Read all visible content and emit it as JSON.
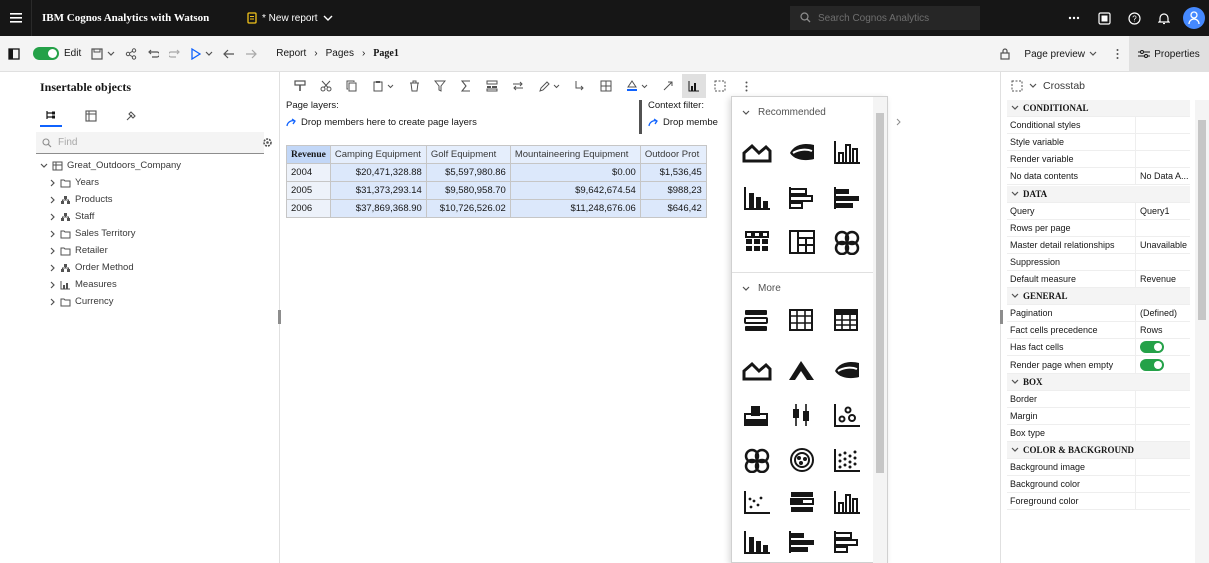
{
  "app": {
    "title": "IBM Cognos Analytics with Watson",
    "report_name": "* New report",
    "search_placeholder": "Search Cognos Analytics"
  },
  "toolbar": {
    "edit_label": "Edit",
    "breadcrumb": [
      "Report",
      "Pages",
      "Page1"
    ],
    "page_preview_label": "Page preview",
    "properties_label": "Properties"
  },
  "left_panel": {
    "title": "Insertable objects",
    "find_placeholder": "Find",
    "tree_root": "Great_Outdoors_Company",
    "tree_items": [
      {
        "label": "Years",
        "icon": "folder-icon"
      },
      {
        "label": "Products",
        "icon": "hierarchy-icon"
      },
      {
        "label": "Staff",
        "icon": "hierarchy-icon"
      },
      {
        "label": "Sales Territory",
        "icon": "folder-icon"
      },
      {
        "label": "Retailer",
        "icon": "folder-icon"
      },
      {
        "label": "Order Method",
        "icon": "hierarchy-icon"
      },
      {
        "label": "Measures",
        "icon": "measure-icon"
      },
      {
        "label": "Currency",
        "icon": "folder-icon"
      }
    ]
  },
  "page_layers": {
    "label": "Page layers:",
    "drop_text": "Drop members here to create page layers"
  },
  "context_filter": {
    "label": "Context filter:",
    "drop_text": "Drop membe"
  },
  "crosstab": {
    "corner": "Revenue",
    "columns": [
      "Camping Equipment",
      "Golf Equipment",
      "Mountaineering Equipment",
      "Outdoor Prot"
    ],
    "rows": [
      {
        "year": "2004",
        "values": [
          "$20,471,328.88",
          "$5,597,980.86",
          "$0.00",
          "$1,536,45"
        ]
      },
      {
        "year": "2005",
        "values": [
          "$31,373,293.14",
          "$9,580,958.70",
          "$9,642,674.54",
          "$988,23"
        ]
      },
      {
        "year": "2006",
        "values": [
          "$37,869,368.90",
          "$10,726,526.02",
          "$11,248,676.06",
          "$646,42"
        ]
      }
    ]
  },
  "viz_flyout": {
    "recommended_label": "Recommended",
    "more_label": "More"
  },
  "properties": {
    "header": "Crosstab",
    "rows": [
      {
        "type": "section",
        "key": "CONDITIONAL"
      },
      {
        "type": "row",
        "key": "Conditional styles",
        "value": ""
      },
      {
        "type": "row",
        "key": "Style variable",
        "value": ""
      },
      {
        "type": "row",
        "key": "Render variable",
        "value": ""
      },
      {
        "type": "row",
        "key": "No data contents",
        "value": "No Data A..."
      },
      {
        "type": "section",
        "key": "DATA"
      },
      {
        "type": "row",
        "key": "Query",
        "value": "Query1"
      },
      {
        "type": "row",
        "key": "Rows per page",
        "value": ""
      },
      {
        "type": "row",
        "key": "Master detail relationships",
        "value": "Unavailable"
      },
      {
        "type": "row",
        "key": "Suppression",
        "value": ""
      },
      {
        "type": "row",
        "key": "Default measure",
        "value": "Revenue"
      },
      {
        "type": "section",
        "key": "GENERAL"
      },
      {
        "type": "row",
        "key": "Pagination",
        "value": "(Defined)"
      },
      {
        "type": "row",
        "key": "Fact cells precedence",
        "value": "Rows"
      },
      {
        "type": "toggle",
        "key": "Has fact cells",
        "value": ""
      },
      {
        "type": "toggle",
        "key": "Render page when empty",
        "value": ""
      },
      {
        "type": "section",
        "key": "BOX"
      },
      {
        "type": "row",
        "key": "Border",
        "value": ""
      },
      {
        "type": "row",
        "key": "Margin",
        "value": ""
      },
      {
        "type": "row",
        "key": "Box type",
        "value": ""
      },
      {
        "type": "section",
        "key": "COLOR & BACKGROUND"
      },
      {
        "type": "row",
        "key": "Background image",
        "value": ""
      },
      {
        "type": "row",
        "key": "Background color",
        "value": ""
      },
      {
        "type": "row",
        "key": "Foreground color",
        "value": ""
      }
    ]
  },
  "colors": {
    "header_bg": "#161616",
    "accent": "#0f62fe",
    "toggle_on": "#24a148",
    "selection": "#d0e2ff"
  }
}
